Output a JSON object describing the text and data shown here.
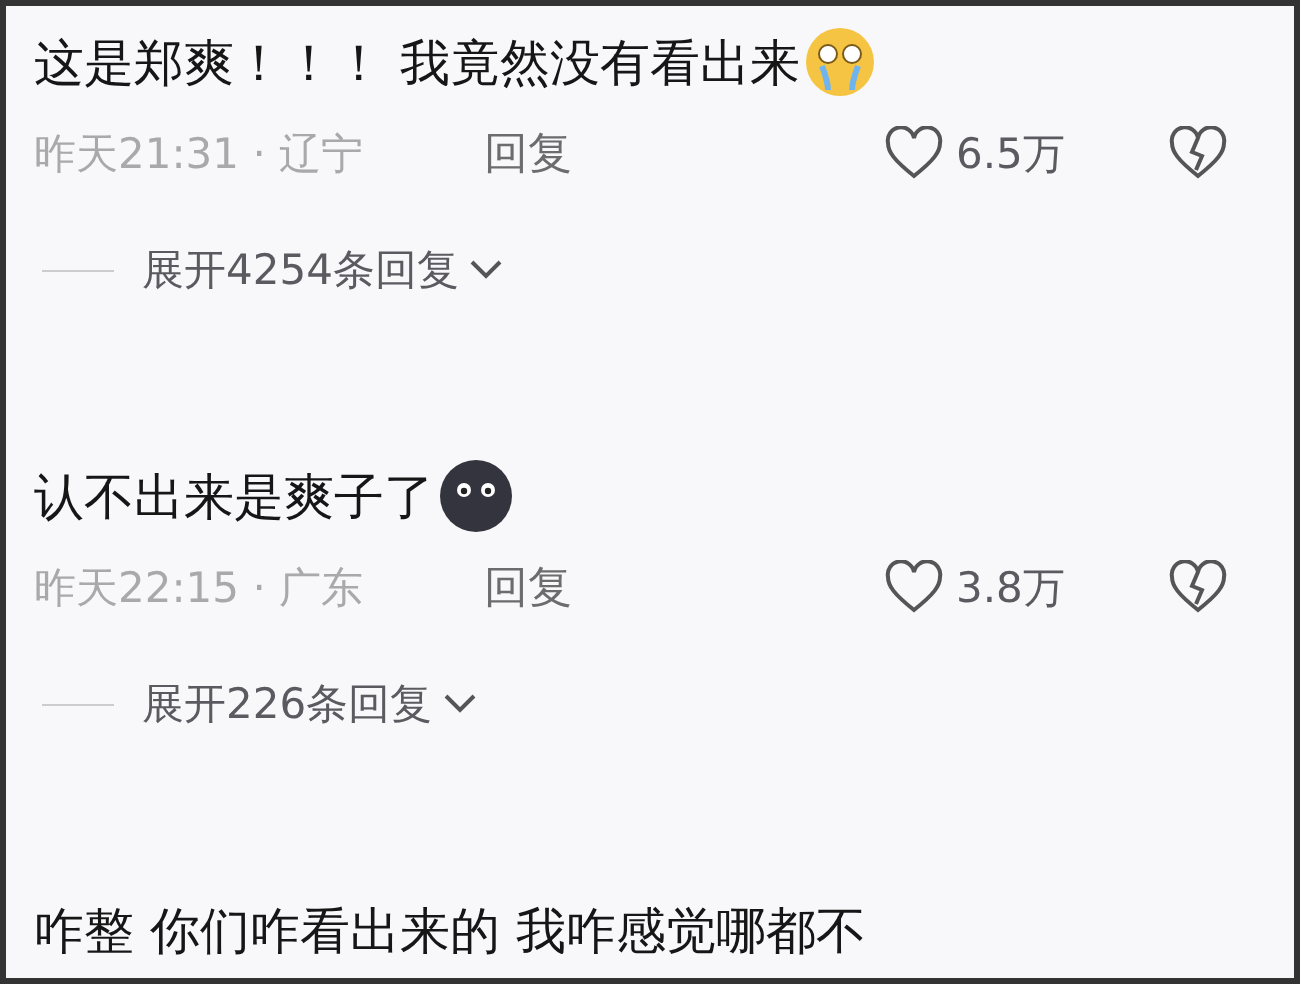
{
  "comments": [
    {
      "text": "这是郑爽！！！ 我竟然没有看出来",
      "kind": "crying",
      "meta": "昨天21:31 · 辽宁",
      "reply": "回复",
      "likes": "6.5万",
      "expand": "展开4254条回复"
    },
    {
      "text": "认不出来是爽子了",
      "kind": "blob",
      "meta": "昨天22:15 · 广东",
      "reply": "回复",
      "likes": "3.8万",
      "expand": "展开226条回复"
    },
    {
      "text": "咋整 你们咋看出来的 我咋感觉哪都不"
    }
  ]
}
